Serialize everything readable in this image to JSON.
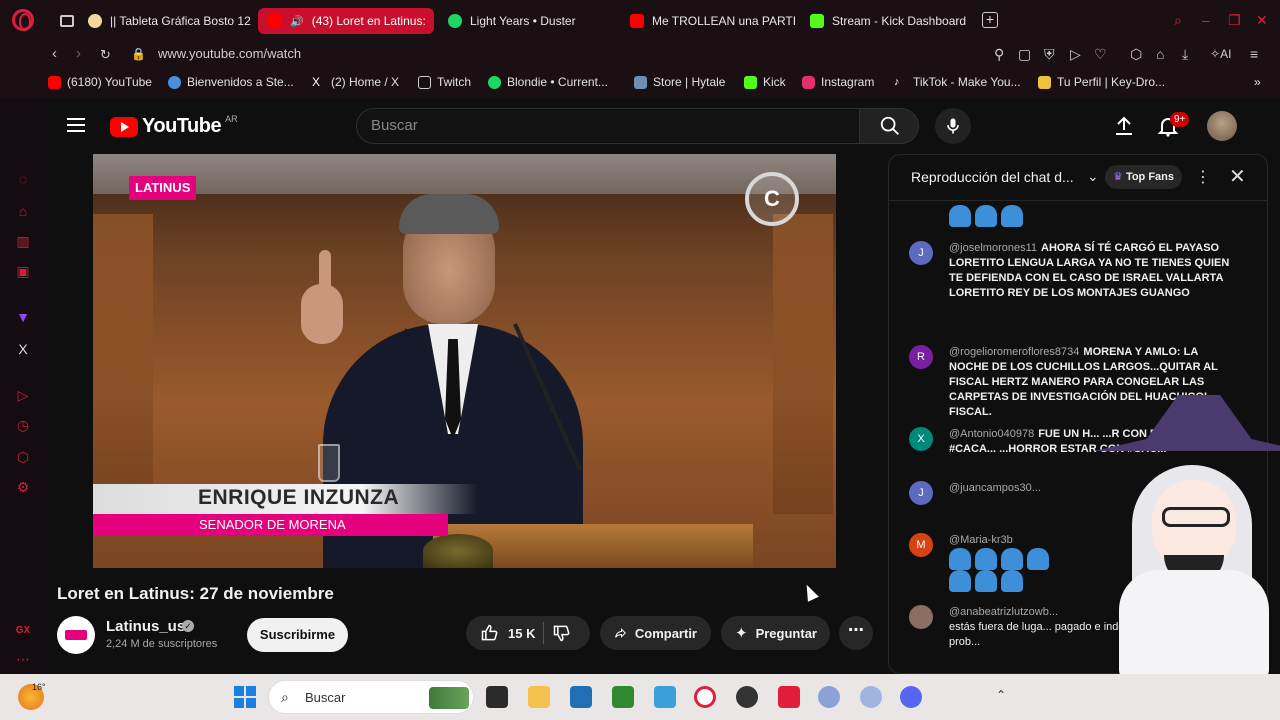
{
  "browser": {
    "tabs": [
      {
        "label": "|| Tableta Gráfica Bosto 12",
        "color": "#f0d89c"
      },
      {
        "label": "(43) Loret en Latinus:",
        "color": "#ff0000",
        "active": true
      },
      {
        "label": "Light Years • Duster",
        "color": "#1ed760"
      },
      {
        "label": "Me TROLLEAN una PARTI",
        "color": "#ff0000"
      },
      {
        "label": "Stream - Kick Dashboard",
        "color": "#53fc18"
      }
    ],
    "url": "www.youtube.com/watch",
    "ai_label": "AI",
    "bookmarks": [
      {
        "label": "(6180) YouTube",
        "color": "#ff0000"
      },
      {
        "label": "Bienvenidos a Ste...",
        "color": "#1b2838"
      },
      {
        "label": "(2) Home / X",
        "color": "#000000"
      },
      {
        "label": "Twitch",
        "color": "#9146ff"
      },
      {
        "label": "Blondie • Current...",
        "color": "#1ed760"
      },
      {
        "label": "Store | Hytale",
        "color": "#4aa3df"
      },
      {
        "label": "Kick",
        "color": "#53fc18"
      },
      {
        "label": "Instagram",
        "color": "#e1306c"
      },
      {
        "label": "TikTok - Make You...",
        "color": "#000000"
      },
      {
        "label": "Tu Perfil | Key-Dro...",
        "color": "#f0c23b"
      }
    ]
  },
  "youtube": {
    "logo_text": "YouTube",
    "country": "AR",
    "search_placeholder": "Buscar",
    "notifications_badge": "9+"
  },
  "video": {
    "overlay_logo": "LATINUS",
    "lower_third_name": "ENRIQUE INZUNZA",
    "lower_third_role": "SENADOR DE MORENA",
    "title": "Loret en Latinus: 27 de noviembre",
    "channel_name": "Latinus_us",
    "subscribers": "2,24 M de suscriptores",
    "subscribe_label": "Suscribirme",
    "likes": "15 K",
    "share_label": "Compartir",
    "ask_label": "Preguntar"
  },
  "chat": {
    "title": "Reproducción del chat d...",
    "top_fans_label": "Top Fans",
    "messages": [
      {
        "initial": "J",
        "color": "#5c6bc0",
        "author": "@joselmorones11",
        "text": "AHORA SÍ TÉ CARGÓ EL PAYASO LORETITO LENGUA LARGA YA NO TE TIENES QUIEN TE DEFIENDA CON EL CASO DE ISRAEL VALLARTA LORETITO REY DE LOS MONTAJES GUANGO"
      },
      {
        "initial": "R",
        "color": "#7b1fa2",
        "author": "@rogelioromeroflores8734",
        "text": "MORENA Y AMLO: LA NOCHE DE LOS CUCHILLOS LARGOS...QUITAR AL FISCAL HERTZ MANERO PARA CONGELAR LAS CARPETAS DE INVESTIGACIÓN DEL HUACHICOL FISCAL."
      },
      {
        "initial": "X",
        "color": "#00897b",
        "author": "@Antonio040978",
        "text": "FUE UN H... ...R CON EL MALO DEL #CACA... ...HORROR ESTAR CON #CAC..."
      },
      {
        "initial": "J",
        "color": "#5c6bc0",
        "author": "@juancampos30...",
        "text": ""
      },
      {
        "initial": "M",
        "color": "#d84315",
        "author": "@Maria-kr3b",
        "text": ""
      },
      {
        "initial": "",
        "color": "#8d6e63",
        "author": "@anabeatrizlutzowb...",
        "text": "estás fuera de luga... pagado e indeseal... para ti, es tu prob..."
      }
    ]
  },
  "taskbar": {
    "temperature": "16°",
    "search_label": "Buscar"
  }
}
